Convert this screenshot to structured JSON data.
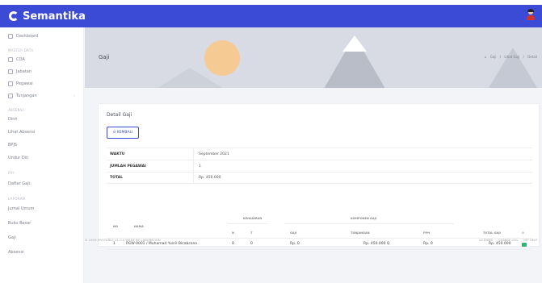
{
  "app": {
    "brand": "Semantika"
  },
  "sidebar": {
    "items": [
      {
        "label": "Dashboard"
      },
      {
        "label": "COA"
      },
      {
        "label": "Jabatan"
      },
      {
        "label": "Pegawai"
      },
      {
        "label": "Tunjangan"
      },
      {
        "label": "Dinh"
      },
      {
        "label": "Lihat Absensi"
      },
      {
        "label": "BPJS"
      },
      {
        "label": "Undur Diri"
      },
      {
        "label": "Daftar Gaji"
      },
      {
        "label": "Jurnal Umum"
      },
      {
        "label": "Buku Besar"
      },
      {
        "label": "Gaji"
      },
      {
        "label": "Absensi"
      }
    ],
    "heads": {
      "master": "MASTER DATA",
      "absensi": "ABSENSI",
      "payroll": "PAY",
      "laporan": "LAPORAN"
    }
  },
  "header": {
    "title": "Gaji",
    "breadcrumb": [
      "⌂",
      "Gaji",
      "/",
      "Lihat Gaji",
      "/",
      "Detail"
    ]
  },
  "card": {
    "title": "Detail Gaji",
    "back_label": "KEMBALI",
    "info": [
      {
        "label": "WAKTU",
        "value": "September 2021"
      },
      {
        "label": "JUMLAH PEGAWAI",
        "value": "1"
      },
      {
        "label": "TOTAL",
        "value": "Rp. 450.000"
      }
    ]
  },
  "table": {
    "group_headers": {
      "kehadiran": "KEHADIRAN",
      "komponen": "KOMPONEN GAJI"
    },
    "headers": {
      "no": "NO",
      "nama": "NAMA",
      "h": "H",
      "t": "T",
      "gaji": "GAJI",
      "tunjangan": "TUNJANGAN",
      "pph": "PPH",
      "total": "TOTAL GAJI",
      "aksi": "⚙"
    },
    "rows": [
      {
        "no": "1",
        "nama": "PGW-0001 / Muhamad Yusril Bicabcono",
        "h": "0",
        "t": "0",
        "gaji": "Rp. 0",
        "tunjangan": "Rp. 450.000 Q",
        "pph": "Rp. 0",
        "total": "Rp. 450.000"
      }
    ]
  },
  "footer": {
    "left": "© 2019 PROTABLE V1.0.0 MADE BY LABORATION",
    "links": [
      "LICENSES",
      "CHANGE LOG",
      "GET HELP"
    ]
  },
  "colors": {
    "primary": "#3b4bd6",
    "success": "#2bb673"
  }
}
